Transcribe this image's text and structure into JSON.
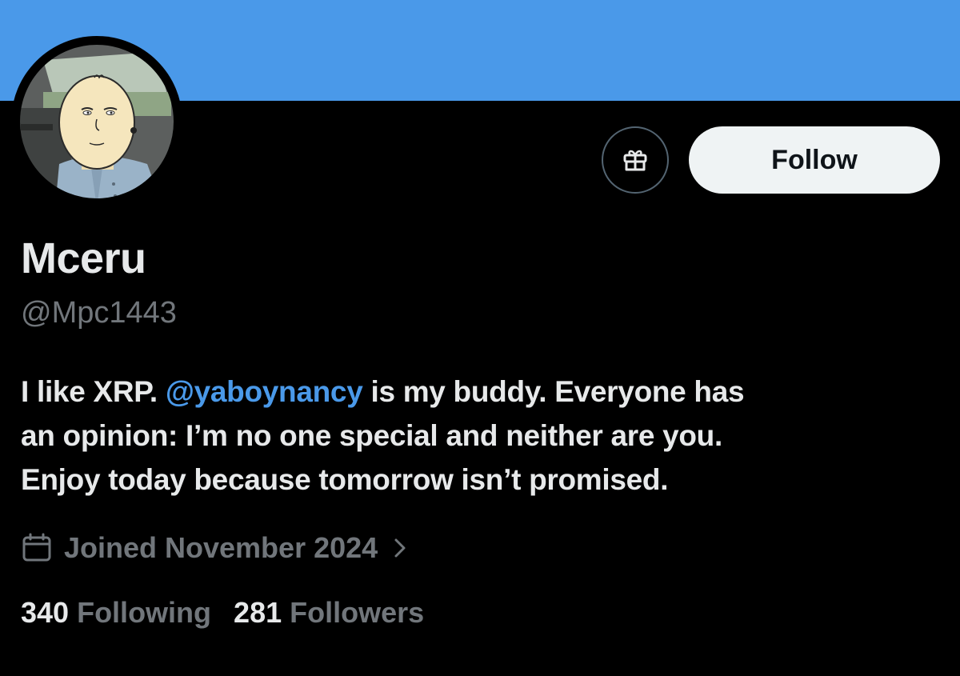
{
  "profile": {
    "display_name": "Mceru",
    "handle": "@Mpc1443",
    "bio": {
      "part1": "I like XRP. ",
      "mention": "@yaboynancy",
      "part2": " is my buddy. Everyone has",
      "line2": "an opinion: I’m no one special and neither are you.",
      "line3": "Enjoy today because tomorrow isn’t promised."
    },
    "joined": "Joined November 2024",
    "following_count": "340",
    "following_label": "Following",
    "followers_count": "281",
    "followers_label": "Followers"
  },
  "actions": {
    "follow_label": "Follow",
    "gift_icon": "gift-icon"
  },
  "colors": {
    "banner": "#4a99e9",
    "background": "#000000",
    "mention": "#4a99e9",
    "muted": "#71767b",
    "follow_button_bg": "#eff3f4"
  }
}
